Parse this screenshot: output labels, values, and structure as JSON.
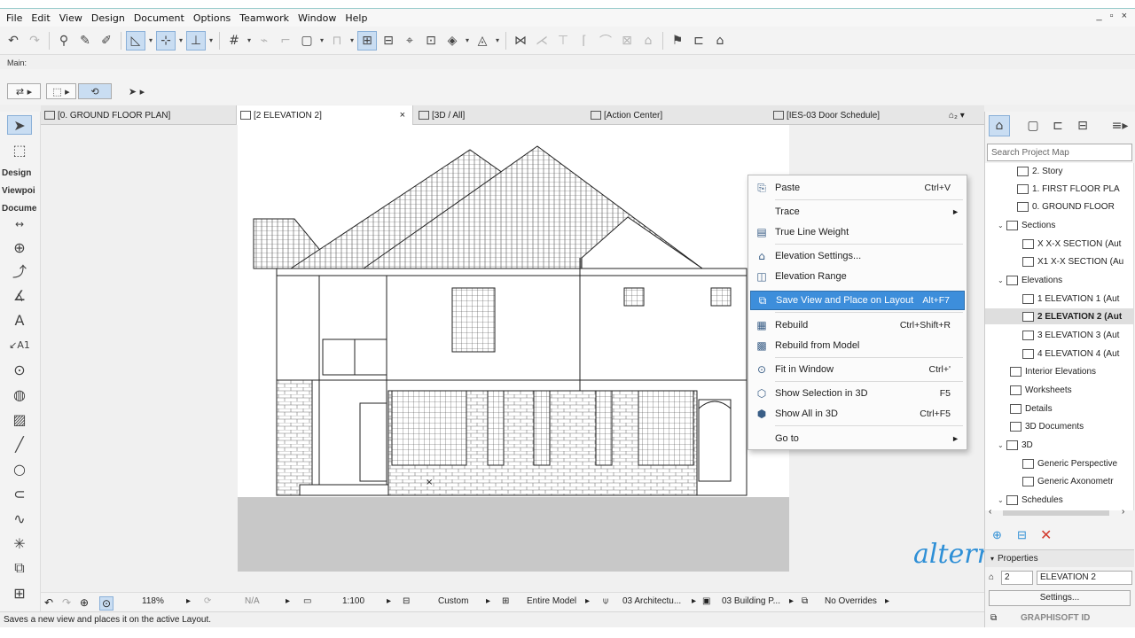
{
  "menu": [
    "File",
    "Edit",
    "View",
    "Design",
    "Document",
    "Options",
    "Teamwork",
    "Window",
    "Help"
  ],
  "window_controls": "_ ▫ ×",
  "main_label": "Main:",
  "tabs": [
    {
      "label": "[0. GROUND FLOOR PLAN]",
      "active": false
    },
    {
      "label": "[2 ELEVATION 2]",
      "active": true
    },
    {
      "label": "[3D / All]",
      "active": false
    },
    {
      "label": "[Action Center]",
      "active": false
    },
    {
      "label": "[IES-03 Door Schedule]",
      "active": false
    }
  ],
  "tab_close": "×",
  "toolbox": {
    "sections": [
      "Design",
      "Viewpoi",
      "Docume"
    ]
  },
  "context_menu": [
    {
      "label": "Paste",
      "shortcut": "Ctrl+V",
      "icon": "paste-icon"
    },
    {
      "label": "Trace",
      "shortcut": "",
      "submenu": true,
      "icon": ""
    },
    {
      "label": "True Line Weight",
      "shortcut": "",
      "icon": "line-weight-icon"
    },
    {
      "label": "Elevation Settings...",
      "shortcut": "",
      "icon": "elevation-settings-icon"
    },
    {
      "label": "Elevation Range",
      "shortcut": "",
      "icon": "elevation-range-icon"
    },
    {
      "label": "Save View and Place on Layout",
      "shortcut": "Alt+F7",
      "icon": "save-view-icon",
      "highlighted": true
    },
    {
      "label": "Rebuild",
      "shortcut": "Ctrl+Shift+R",
      "icon": "rebuild-icon"
    },
    {
      "label": "Rebuild from Model",
      "shortcut": "",
      "icon": "rebuild-model-icon"
    },
    {
      "label": "Fit in Window",
      "shortcut": "Ctrl+'",
      "icon": "fit-window-icon"
    },
    {
      "label": "Show Selection in 3D",
      "shortcut": "F5",
      "icon": "show-selection-3d-icon"
    },
    {
      "label": "Show All in 3D",
      "shortcut": "Ctrl+F5",
      "icon": "show-all-3d-icon"
    },
    {
      "label": "Go to",
      "shortcut": "",
      "submenu": true,
      "icon": ""
    }
  ],
  "navigator": {
    "search_placeholder": "Search Project Map",
    "items": [
      {
        "label": "2. Story",
        "level": 2
      },
      {
        "label": "1. FIRST FLOOR PLA",
        "level": 2
      },
      {
        "label": "0. GROUND FLOOR",
        "level": 2
      },
      {
        "label": "Sections",
        "level": 1,
        "expanded": true
      },
      {
        "label": "X X-X SECTION (Aut",
        "level": 2
      },
      {
        "label": "X1 X-X SECTION (Au",
        "level": 2
      },
      {
        "label": "Elevations",
        "level": 1,
        "expanded": true
      },
      {
        "label": "1 ELEVATION 1 (Aut",
        "level": 2
      },
      {
        "label": "2 ELEVATION 2 (Aut",
        "level": 2,
        "selected": true
      },
      {
        "label": "3 ELEVATION 3 (Aut",
        "level": 2
      },
      {
        "label": "4 ELEVATION 4 (Aut",
        "level": 2
      },
      {
        "label": "Interior Elevations",
        "level": 1
      },
      {
        "label": "Worksheets",
        "level": 1
      },
      {
        "label": "Details",
        "level": 1
      },
      {
        "label": "3D Documents",
        "level": 1
      },
      {
        "label": "3D",
        "level": 1,
        "expanded": true
      },
      {
        "label": "Generic Perspective",
        "level": 2
      },
      {
        "label": "Generic Axonometr",
        "level": 2
      },
      {
        "label": "Schedules",
        "level": 1,
        "expanded": true
      }
    ],
    "properties_label": "Properties",
    "prop_id": "2",
    "prop_name": "ELEVATION 2",
    "settings_button": "Settings...",
    "graphisoft_label": "GRAPHISOFT ID"
  },
  "watermark": "alterr",
  "canvas_bar": {
    "zoom": "118%",
    "na": "N/A",
    "scale": "1:100",
    "pen_set": "Custom",
    "model_view": "Entire Model",
    "layer": "03 Architectu...",
    "view_option": "03 Building P...",
    "overrides": "No Overrides"
  },
  "status_text": "Saves a new view and places it on the active Layout."
}
